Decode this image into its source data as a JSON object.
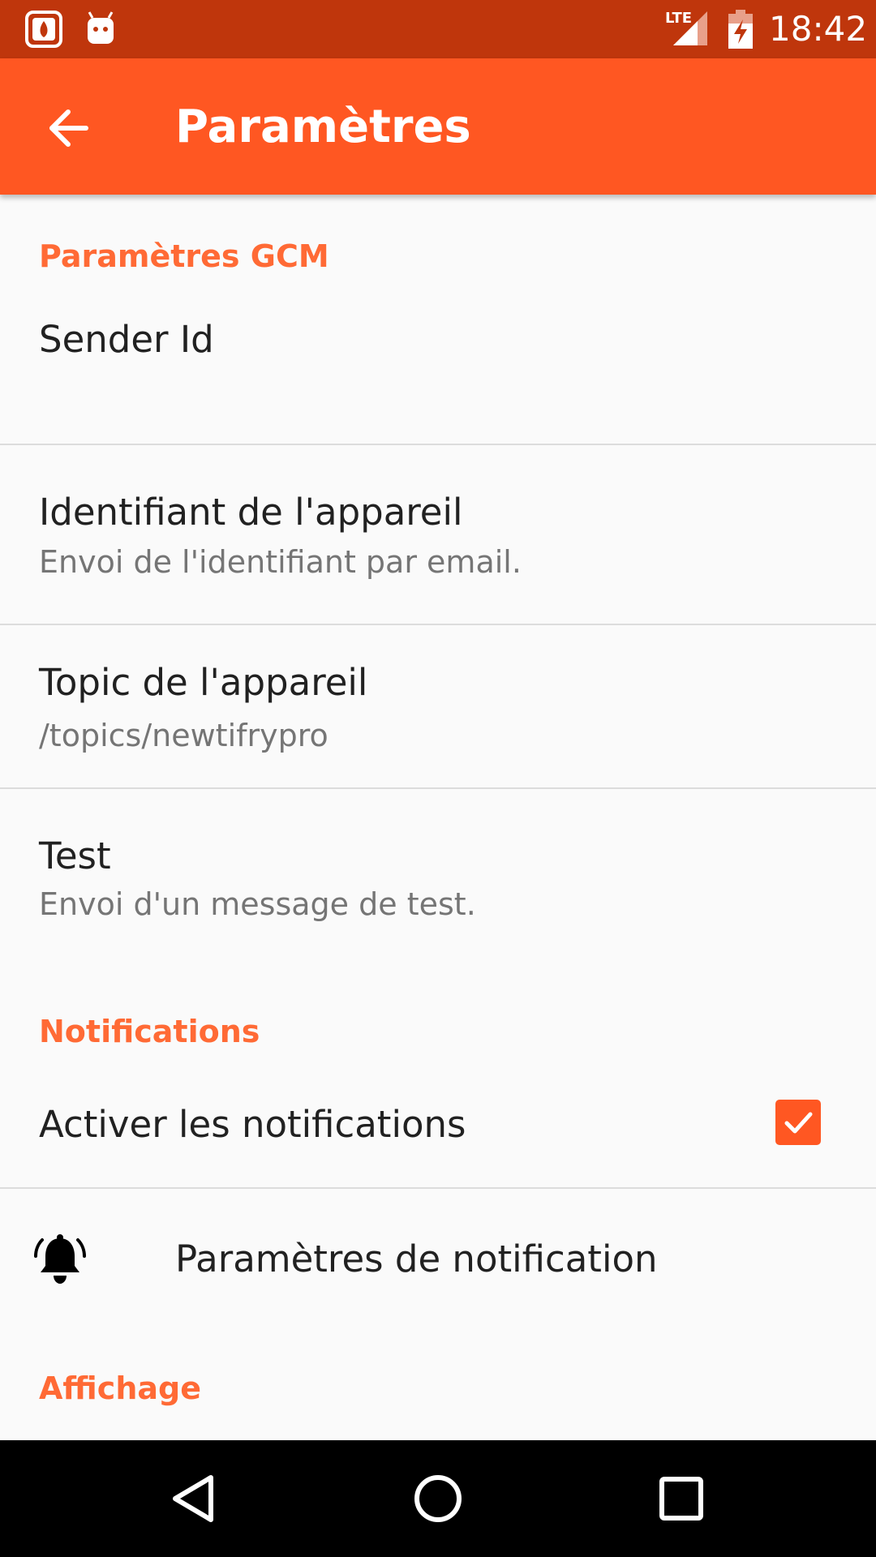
{
  "status_bar": {
    "time": "18:42",
    "network_label": "LTE",
    "icons": [
      "app-notification-icon",
      "android-debug-icon",
      "lte-signal-icon",
      "battery-charging-icon"
    ]
  },
  "app_bar": {
    "title": "Paramètres",
    "back_icon": "arrow-back-icon",
    "color": "#ff5722"
  },
  "sections": {
    "gcm": {
      "header": "Paramètres GCM",
      "sender_id": {
        "title": "Sender Id"
      },
      "device_id": {
        "title": "Identifiant de l'appareil",
        "summary": "Envoi de l'identifiant par email."
      },
      "device_topic": {
        "title": "Topic de l'appareil",
        "summary": "/topics/newtifrypro"
      },
      "test": {
        "title": "Test",
        "summary": "Envoi d'un message de test."
      }
    },
    "notifications": {
      "header": "Notifications",
      "enable": {
        "title": "Activer les notifications",
        "checked": true
      },
      "settings": {
        "title": "Paramètres de notification",
        "icon": "bell-icon"
      }
    },
    "display": {
      "header": "Affichage"
    }
  },
  "nav_bar": {
    "icons": [
      "back-triangle-icon",
      "home-circle-icon",
      "recents-square-icon"
    ]
  },
  "colors": {
    "status_bar": "#bf360c",
    "accent": "#ff5722",
    "category_text": "#ff6a35"
  }
}
